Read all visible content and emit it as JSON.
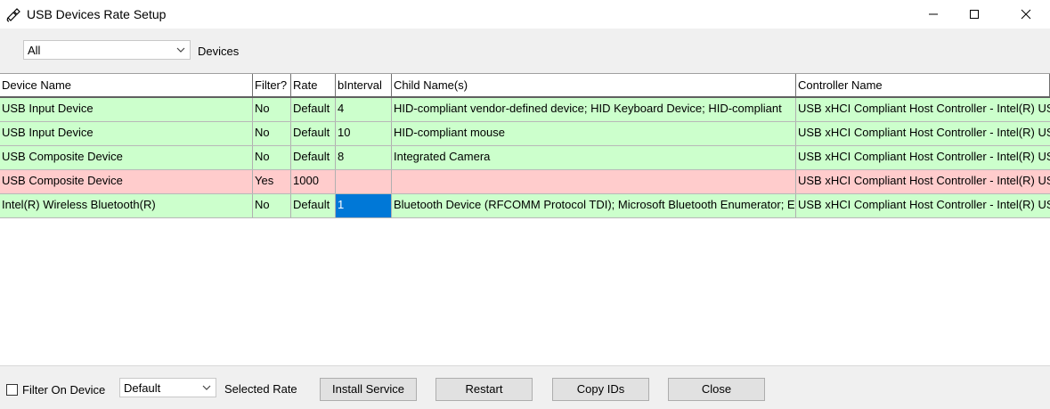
{
  "window": {
    "title": "USB Devices Rate Setup",
    "controls": [
      "minimize-icon",
      "maximize-icon",
      "close-icon"
    ]
  },
  "filter": {
    "selected": "All",
    "label": "Devices"
  },
  "table": {
    "headers": [
      "Device Name",
      "Filter?",
      "Rate",
      "bInterval",
      "Child Name(s)",
      "Controller Name"
    ],
    "rows": [
      [
        "USB Input Device",
        "No",
        "Default",
        "4",
        "HID-compliant vendor-defined device; HID Keyboard Device; HID-compliant",
        "USB xHCI Compliant Host Controller - Intel(R) US"
      ],
      [
        "USB Input Device",
        "No",
        "Default",
        "10",
        "HID-compliant mouse",
        "USB xHCI Compliant Host Controller - Intel(R) US"
      ],
      [
        "USB Composite Device",
        "No",
        "Default",
        "8",
        "Integrated Camera",
        "USB xHCI Compliant Host Controller - Intel(R) US"
      ],
      [
        "USB Composite Device",
        "Yes",
        "1000",
        "",
        "",
        "USB xHCI Compliant Host Controller - Intel(R) US"
      ],
      [
        "Intel(R) Wireless Bluetooth(R)",
        "No",
        "Default",
        "1",
        "Bluetooth Device (RFCOMM Protocol TDI); Microsoft Bluetooth Enumerator; E",
        "USB xHCI Compliant Host Controller - Intel(R) US"
      ]
    ],
    "row_status": [
      "green",
      "green",
      "green",
      "red",
      "green"
    ],
    "colors": {
      "green": "#ccffcc",
      "red": "#ffcccc",
      "selection": "#0078d7"
    }
  },
  "bottom": {
    "filter_checkbox_label": "Filter On Device",
    "filter_checked": false,
    "rate_selected": "Default",
    "rate_label": "Selected Rate",
    "buttons": [
      "Install Service",
      "Restart",
      "Copy IDs",
      "Close"
    ]
  }
}
